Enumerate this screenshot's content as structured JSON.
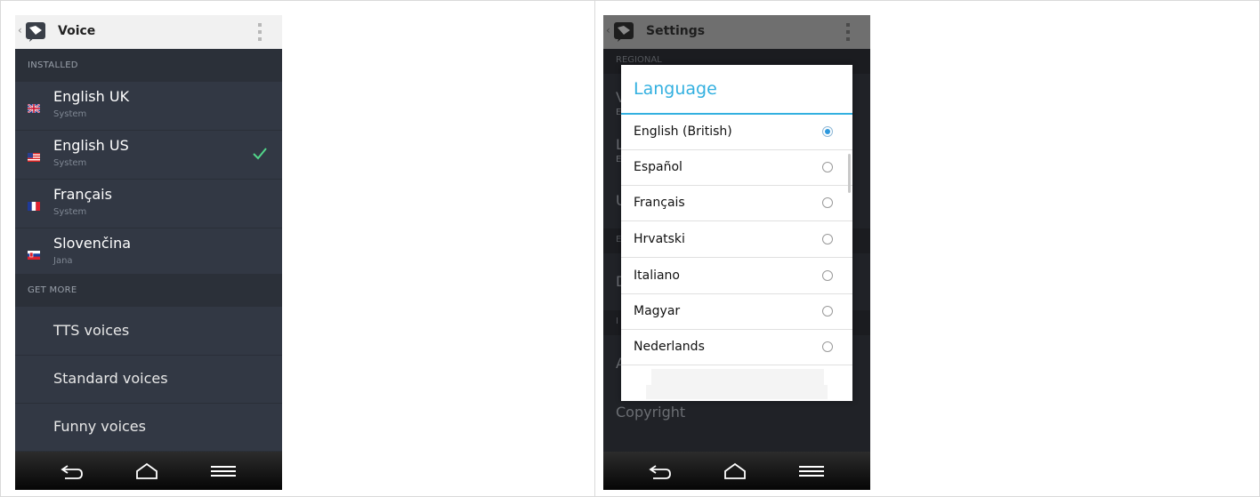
{
  "left_screen": {
    "appbar": {
      "back": "‹",
      "title": "Voice"
    },
    "sections": {
      "installed": "INSTALLED",
      "get_more": "GET MORE"
    },
    "voices": [
      {
        "name": "English UK",
        "sub": "System",
        "flag": "uk-flag-icon",
        "selected": false
      },
      {
        "name": "English US",
        "sub": "System",
        "flag": "us-flag-icon",
        "selected": true
      },
      {
        "name": "Français",
        "sub": "System",
        "flag": "france-flag-icon",
        "selected": false
      },
      {
        "name": "Slovenčina",
        "sub": "Jana",
        "flag": "slovakia-flag-icon",
        "selected": false
      }
    ],
    "more_items": [
      "TTS voices",
      "Standard voices",
      "Funny voices"
    ],
    "colors": {
      "check": "#52d68a",
      "background": "#323844",
      "section": "#2b3039"
    }
  },
  "right_screen": {
    "appbar": {
      "back": "‹",
      "title": "Settings"
    },
    "background": {
      "sections": [
        "REGIONAL",
        "E",
        "I"
      ],
      "letters": [
        "V",
        "E",
        "L",
        "E",
        "U",
        "D",
        "A"
      ],
      "copyright": "Copyright"
    },
    "dialog": {
      "title": "Language",
      "options": [
        {
          "label": "English (British)",
          "selected": true
        },
        {
          "label": "Español",
          "selected": false
        },
        {
          "label": "Français",
          "selected": false
        },
        {
          "label": "Hrvatski",
          "selected": false
        },
        {
          "label": "Italiano",
          "selected": false
        },
        {
          "label": "Magyar",
          "selected": false
        },
        {
          "label": "Nederlands",
          "selected": false
        }
      ],
      "accent": "#33b0e0"
    }
  },
  "navbar": {
    "icons": [
      "back-icon",
      "home-icon",
      "menu-icon"
    ]
  }
}
